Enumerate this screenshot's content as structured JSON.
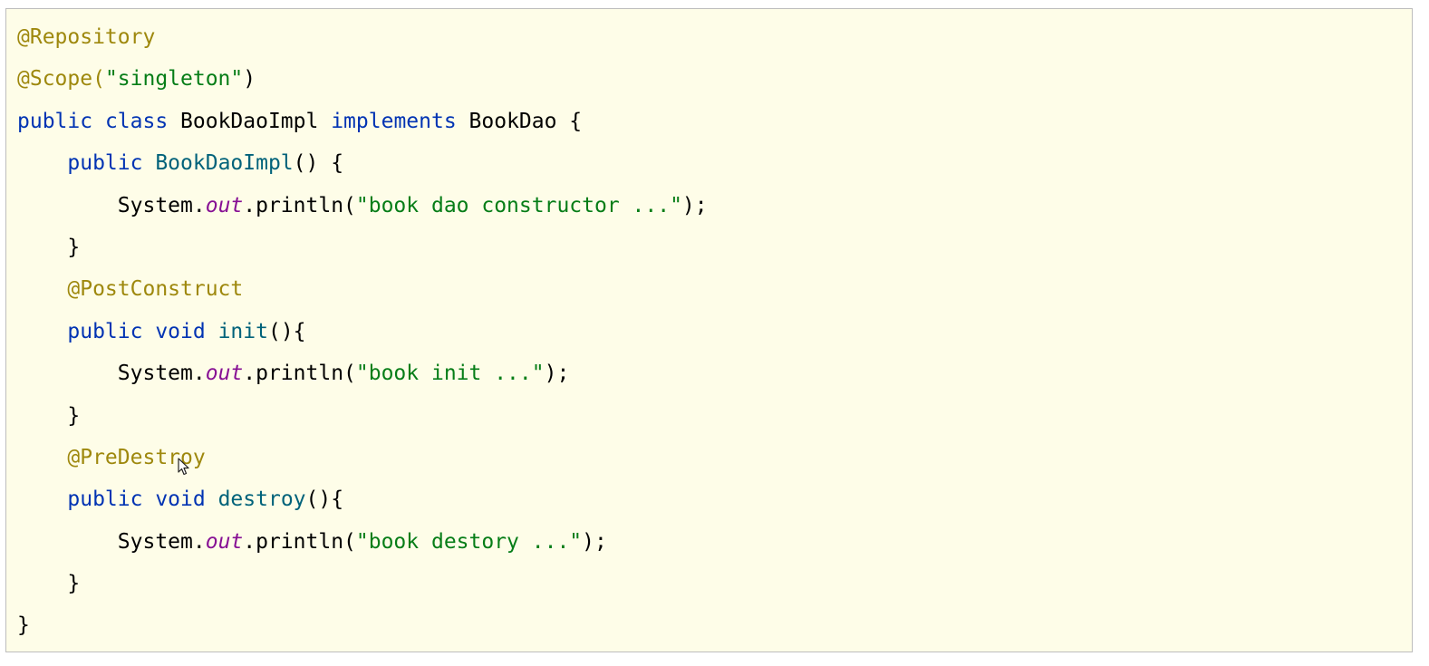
{
  "code_block": {
    "lines": [
      [
        {
          "t": "@Repository",
          "c": "ann"
        }
      ],
      [
        {
          "t": "@Scope(",
          "c": "ann"
        },
        {
          "t": "\"singleton\"",
          "c": "str"
        },
        {
          "t": ")",
          "c": "plain"
        }
      ],
      [
        {
          "t": "public ",
          "c": "kw"
        },
        {
          "t": "class ",
          "c": "kw"
        },
        {
          "t": "BookDaoImpl ",
          "c": "plain"
        },
        {
          "t": "implements ",
          "c": "kw"
        },
        {
          "t": "BookDao {",
          "c": "plain"
        }
      ],
      [
        {
          "t": "    ",
          "c": "plain"
        },
        {
          "t": "public ",
          "c": "kw"
        },
        {
          "t": "BookDaoImpl",
          "c": "fn"
        },
        {
          "t": "() {",
          "c": "plain"
        }
      ],
      [
        {
          "t": "        System.",
          "c": "plain"
        },
        {
          "t": "out",
          "c": "field"
        },
        {
          "t": ".println(",
          "c": "plain"
        },
        {
          "t": "\"book dao constructor ...\"",
          "c": "str"
        },
        {
          "t": ");",
          "c": "plain"
        }
      ],
      [
        {
          "t": "    }",
          "c": "plain"
        }
      ],
      [
        {
          "t": "    ",
          "c": "plain"
        },
        {
          "t": "@PostConstruct",
          "c": "ann"
        }
      ],
      [
        {
          "t": "    ",
          "c": "plain"
        },
        {
          "t": "public ",
          "c": "kw"
        },
        {
          "t": "void ",
          "c": "kw"
        },
        {
          "t": "init",
          "c": "fn"
        },
        {
          "t": "(){",
          "c": "plain"
        }
      ],
      [
        {
          "t": "        System.",
          "c": "plain"
        },
        {
          "t": "out",
          "c": "field"
        },
        {
          "t": ".println(",
          "c": "plain"
        },
        {
          "t": "\"book init ...\"",
          "c": "str"
        },
        {
          "t": ");",
          "c": "plain"
        }
      ],
      [
        {
          "t": "    }",
          "c": "plain"
        }
      ],
      [
        {
          "t": "    ",
          "c": "plain"
        },
        {
          "t": "@PreDestroy",
          "c": "ann"
        }
      ],
      [
        {
          "t": "    ",
          "c": "plain"
        },
        {
          "t": "public ",
          "c": "kw"
        },
        {
          "t": "void ",
          "c": "kw"
        },
        {
          "t": "destroy",
          "c": "fn"
        },
        {
          "t": "(){",
          "c": "plain"
        }
      ],
      [
        {
          "t": "        System.",
          "c": "plain"
        },
        {
          "t": "out",
          "c": "field"
        },
        {
          "t": ".println(",
          "c": "plain"
        },
        {
          "t": "\"book destory ...\"",
          "c": "str"
        },
        {
          "t": ");",
          "c": "plain"
        }
      ],
      [
        {
          "t": "    }",
          "c": "plain"
        }
      ],
      [
        {
          "t": "}",
          "c": "plain"
        }
      ]
    ]
  },
  "colors": {
    "background": "#fefde8",
    "border": "#bdbdbd",
    "annotation": "#9e880d",
    "keyword": "#0033b3",
    "string": "#067d17",
    "method_name": "#00627a",
    "static_field": "#871094",
    "plain": "#000000"
  },
  "pointer": {
    "icon": "mouse-pointer-icon"
  }
}
